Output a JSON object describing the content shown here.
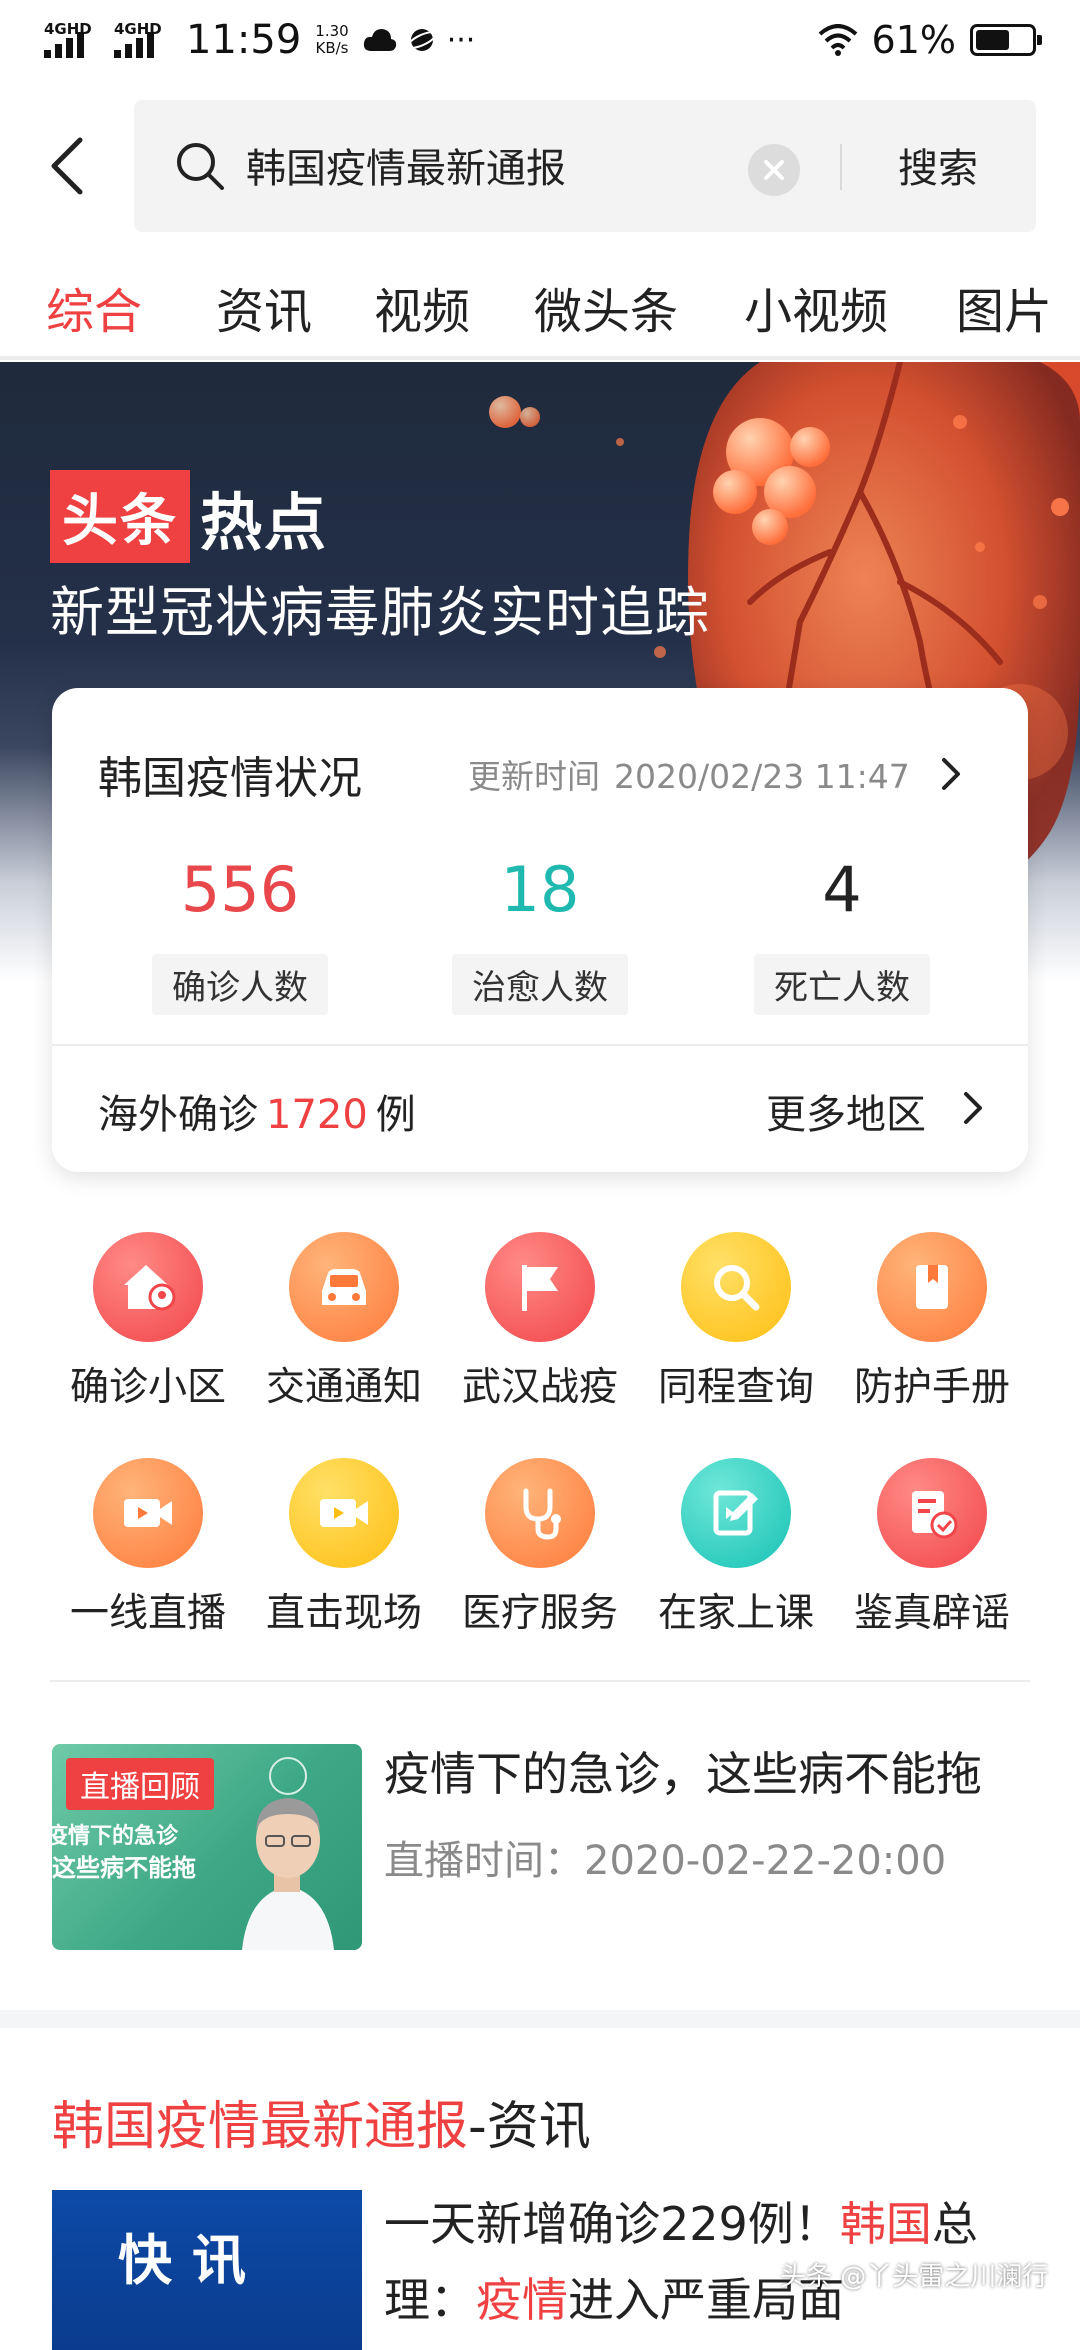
{
  "status_bar": {
    "net1": "4GHD",
    "net2": "4GHD",
    "time": "11:59",
    "speed_value": "1.30",
    "speed_unit": "KB/s",
    "more": "···",
    "battery": "61%",
    "battery_level": 0.61
  },
  "search": {
    "query": "韩国疫情最新通报",
    "submit_label": "搜索"
  },
  "tabs": [
    {
      "label": "综合",
      "active": true
    },
    {
      "label": "资讯"
    },
    {
      "label": "视频"
    },
    {
      "label": "微头条"
    },
    {
      "label": "小视频"
    },
    {
      "label": "图片"
    }
  ],
  "banner": {
    "brand_red": "头条",
    "brand_white": "热点",
    "subtitle": "新型冠状病毒肺炎实时追踪"
  },
  "stats_card": {
    "title": "韩国疫情状况",
    "update_label": "更新时间",
    "update_time": "2020/02/23 11:47",
    "stats": [
      {
        "value": "556",
        "label": "确诊人数",
        "color": "#e8484c"
      },
      {
        "value": "18",
        "label": "治愈人数",
        "color": "#1fb9b0"
      },
      {
        "value": "4",
        "label": "死亡人数",
        "color": "#222222"
      }
    ],
    "overseas_prefix": "海外确诊",
    "overseas_count": "1720",
    "overseas_suffix": "例",
    "more_regions": "更多地区"
  },
  "services": [
    {
      "label": "确诊小区",
      "icon": "home-pin-icon",
      "color": "red"
    },
    {
      "label": "交通通知",
      "icon": "car-icon",
      "color": "orange"
    },
    {
      "label": "武汉战疫",
      "icon": "flag-icon",
      "color": "red"
    },
    {
      "label": "同程查询",
      "icon": "search-icon",
      "color": "yellow"
    },
    {
      "label": "防护手册",
      "icon": "book-icon",
      "color": "orange"
    },
    {
      "label": "一线直播",
      "icon": "video-camera-icon",
      "color": "orange"
    },
    {
      "label": "直击现场",
      "icon": "video-camera-icon",
      "color": "yellow"
    },
    {
      "label": "医疗服务",
      "icon": "stethoscope-icon",
      "color": "orange"
    },
    {
      "label": "在家上课",
      "icon": "edit-icon",
      "color": "teal"
    },
    {
      "label": "鉴真辟谣",
      "icon": "verified-document-icon",
      "color": "red"
    }
  ],
  "live_item": {
    "tag": "直播回顾",
    "thumb_caption1": "疫情下的急诊",
    "thumb_caption2": "这些病不能拖",
    "title": "疫情下的急诊，这些病不能拖",
    "time_label": "直播时间：",
    "time": "2020-02-22-20:00"
  },
  "section": {
    "highlight": "韩国疫情最新通报",
    "rest": "-资讯"
  },
  "news": {
    "thumb_text": "快讯",
    "title_part1": "一天新增确诊229例！",
    "title_hl1": "韩国",
    "title_part2": "总理：",
    "title_hl2": "疫情",
    "title_part3": "进入严重局面"
  },
  "watermark": "头条 @丫头雷之川澜行",
  "colors": {
    "accent": "#f04142"
  }
}
